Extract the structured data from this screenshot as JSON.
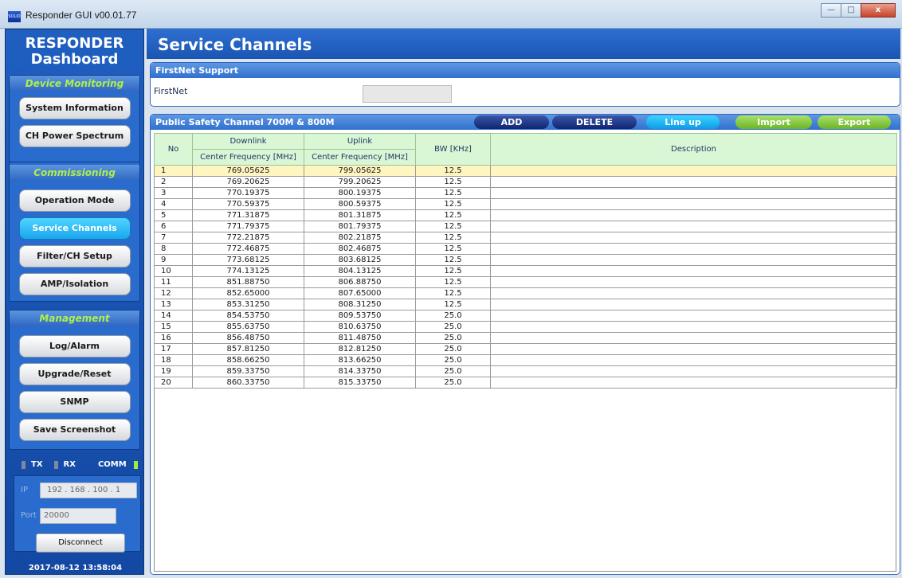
{
  "window": {
    "title": "Responder GUI v00.01.77",
    "app_icon_text": "SOLiD",
    "buttons": {
      "minimize": "—",
      "maximize": "□",
      "close": "x"
    }
  },
  "sidebar": {
    "title_line1": "RESPONDER",
    "title_line2": "Dashboard",
    "sections": [
      {
        "heading": "Device Monitoring",
        "items": [
          {
            "label": "System Information",
            "active": false
          },
          {
            "label": "CH Power Spectrum",
            "active": false
          }
        ]
      },
      {
        "heading": "Commissioning",
        "items": [
          {
            "label": "Operation Mode",
            "active": false
          },
          {
            "label": "Service Channels",
            "active": true
          },
          {
            "label": "Filter/CH Setup",
            "active": false
          },
          {
            "label": "AMP/Isolation",
            "active": false
          }
        ]
      },
      {
        "heading": "Management",
        "items": [
          {
            "label": "Log/Alarm",
            "active": false
          },
          {
            "label": "Upgrade/Reset",
            "active": false
          },
          {
            "label": "SNMP",
            "active": false
          },
          {
            "label": "Save Screenshot",
            "active": false
          }
        ]
      }
    ],
    "status": {
      "tx": "TX",
      "rx": "RX",
      "comm": "COMM"
    },
    "connection": {
      "ip_label": "IP",
      "ip_value": "192 . 168 . 100 .  1",
      "port_label": "Port",
      "port_value": "20000",
      "disconnect_label": "Disconnect"
    },
    "timestamp": "2017-08-12 13:58:04"
  },
  "main": {
    "page_title": "Service Channels",
    "firstnet": {
      "header": "FirstNet Support",
      "label": "FirstNet",
      "value": ""
    },
    "channels": {
      "header": "Public Safety Channel 700M & 800M",
      "toolbar": {
        "add": "ADD",
        "delete": "DELETE",
        "lineup": "Line up",
        "import": "Import",
        "export": "Export"
      },
      "columns": {
        "no": "No",
        "downlink": "Downlink",
        "uplink": "Uplink",
        "center_freq": "Center Frequency [MHz]",
        "bw": "BW [KHz]",
        "description": "Description"
      },
      "selected_row": 1,
      "rows": [
        {
          "no": "1",
          "downlink": "769.05625",
          "uplink": "799.05625",
          "bw": "12.5",
          "description": ""
        },
        {
          "no": "2",
          "downlink": "769.20625",
          "uplink": "799.20625",
          "bw": "12.5",
          "description": ""
        },
        {
          "no": "3",
          "downlink": "770.19375",
          "uplink": "800.19375",
          "bw": "12.5",
          "description": ""
        },
        {
          "no": "4",
          "downlink": "770.59375",
          "uplink": "800.59375",
          "bw": "12.5",
          "description": ""
        },
        {
          "no": "5",
          "downlink": "771.31875",
          "uplink": "801.31875",
          "bw": "12.5",
          "description": ""
        },
        {
          "no": "6",
          "downlink": "771.79375",
          "uplink": "801.79375",
          "bw": "12.5",
          "description": ""
        },
        {
          "no": "7",
          "downlink": "772.21875",
          "uplink": "802.21875",
          "bw": "12.5",
          "description": ""
        },
        {
          "no": "8",
          "downlink": "772.46875",
          "uplink": "802.46875",
          "bw": "12.5",
          "description": ""
        },
        {
          "no": "9",
          "downlink": "773.68125",
          "uplink": "803.68125",
          "bw": "12.5",
          "description": ""
        },
        {
          "no": "10",
          "downlink": "774.13125",
          "uplink": "804.13125",
          "bw": "12.5",
          "description": ""
        },
        {
          "no": "11",
          "downlink": "851.88750",
          "uplink": "806.88750",
          "bw": "12.5",
          "description": ""
        },
        {
          "no": "12",
          "downlink": "852.65000",
          "uplink": "807.65000",
          "bw": "12.5",
          "description": ""
        },
        {
          "no": "13",
          "downlink": "853.31250",
          "uplink": "808.31250",
          "bw": "12.5",
          "description": ""
        },
        {
          "no": "14",
          "downlink": "854.53750",
          "uplink": "809.53750",
          "bw": "25.0",
          "description": ""
        },
        {
          "no": "15",
          "downlink": "855.63750",
          "uplink": "810.63750",
          "bw": "25.0",
          "description": ""
        },
        {
          "no": "16",
          "downlink": "856.48750",
          "uplink": "811.48750",
          "bw": "25.0",
          "description": ""
        },
        {
          "no": "17",
          "downlink": "857.81250",
          "uplink": "812.81250",
          "bw": "25.0",
          "description": ""
        },
        {
          "no": "18",
          "downlink": "858.66250",
          "uplink": "813.66250",
          "bw": "25.0",
          "description": ""
        },
        {
          "no": "19",
          "downlink": "859.33750",
          "uplink": "814.33750",
          "bw": "25.0",
          "description": ""
        },
        {
          "no": "20",
          "downlink": "860.33750",
          "uplink": "815.33750",
          "bw": "25.0",
          "description": ""
        }
      ]
    }
  }
}
